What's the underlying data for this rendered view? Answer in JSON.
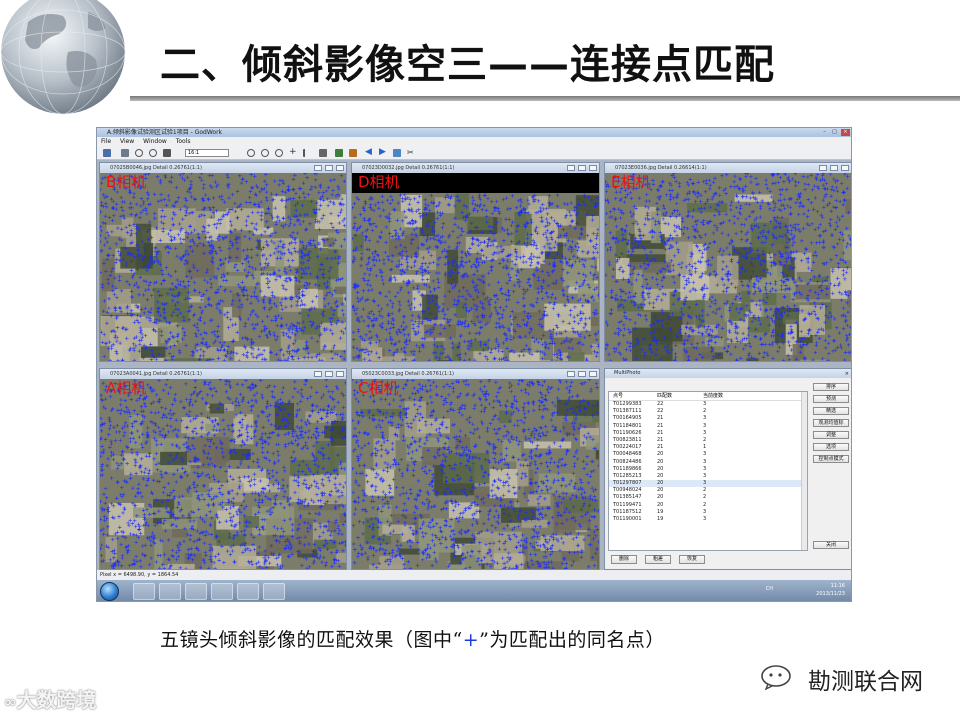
{
  "slide": {
    "title": "二、倾斜影像空三——连接点匹配",
    "caption_before": "五镜头倾斜影像的匹配效果（图中“",
    "caption_plus": "+",
    "caption_after": "”为匹配出的同名点）"
  },
  "app": {
    "title": "A.倾斜影像试验测区试验1项目 - GodWork",
    "menu": [
      "File",
      "View",
      "Window",
      "Tools"
    ],
    "zoom_value": "16:1",
    "status": "Pixel x = 6498.90, y = 1864.54"
  },
  "windows": [
    {
      "id": "b",
      "title": "07025B0046.jpg Detail 0.26761(1:1)",
      "label": "B相机"
    },
    {
      "id": "d",
      "title": "07023D0032.jpg Detail 0.26761(1:1)",
      "label": "D相机"
    },
    {
      "id": "e",
      "title": "07023E0036.jpg Detail 0.26614(1:1)",
      "label": "E相机"
    },
    {
      "id": "a",
      "title": "07023A0041.jpg Detail 0.26761(1:1)",
      "label": "A相机"
    },
    {
      "id": "c",
      "title": "05023C0033.jpg Detail 0.26761(1:1)",
      "label": "C相机"
    }
  ],
  "multiphoto": {
    "title": "MultiPhoto",
    "columns": [
      "点号",
      "匹配数",
      "当前度数"
    ],
    "rows": [
      [
        "T01299383",
        "22",
        "3"
      ],
      [
        "T01387111",
        "22",
        "2"
      ],
      [
        "T00164905",
        "21",
        "3"
      ],
      [
        "T01184801",
        "21",
        "3"
      ],
      [
        "T01190626",
        "21",
        "3"
      ],
      [
        "T00823811",
        "21",
        "2"
      ],
      [
        "T00224017",
        "21",
        "1"
      ],
      [
        "T00048468",
        "20",
        "3"
      ],
      [
        "T00824486",
        "20",
        "3"
      ],
      [
        "T01189866",
        "20",
        "3"
      ],
      [
        "T01285213",
        "20",
        "3"
      ],
      [
        "T01297807",
        "20",
        "3"
      ],
      [
        "T00948024",
        "20",
        "2"
      ],
      [
        "T01385147",
        "20",
        "2"
      ],
      [
        "T01199471",
        "20",
        "2"
      ],
      [
        "T01187512",
        "19",
        "3"
      ],
      [
        "T01190001",
        "19",
        "3"
      ]
    ],
    "selected_row": 11,
    "side_buttons": [
      "排序",
      "预测",
      "精选",
      "观测均值标",
      "调整",
      "选项",
      "控制点模式"
    ],
    "close_button": "关闭",
    "bottom_buttons": [
      "删除",
      "粗差",
      "恢复"
    ]
  },
  "taskbar": {
    "lang": "CH",
    "time": "11:16",
    "date": "2013/11/23"
  },
  "watermarks": {
    "right_text": "勘测联合网",
    "left_text": "大数跨境"
  },
  "colors": {
    "match_points": "#1a2cff",
    "camera_label": "#ee1111",
    "caption_plus": "#1a3bd9"
  }
}
